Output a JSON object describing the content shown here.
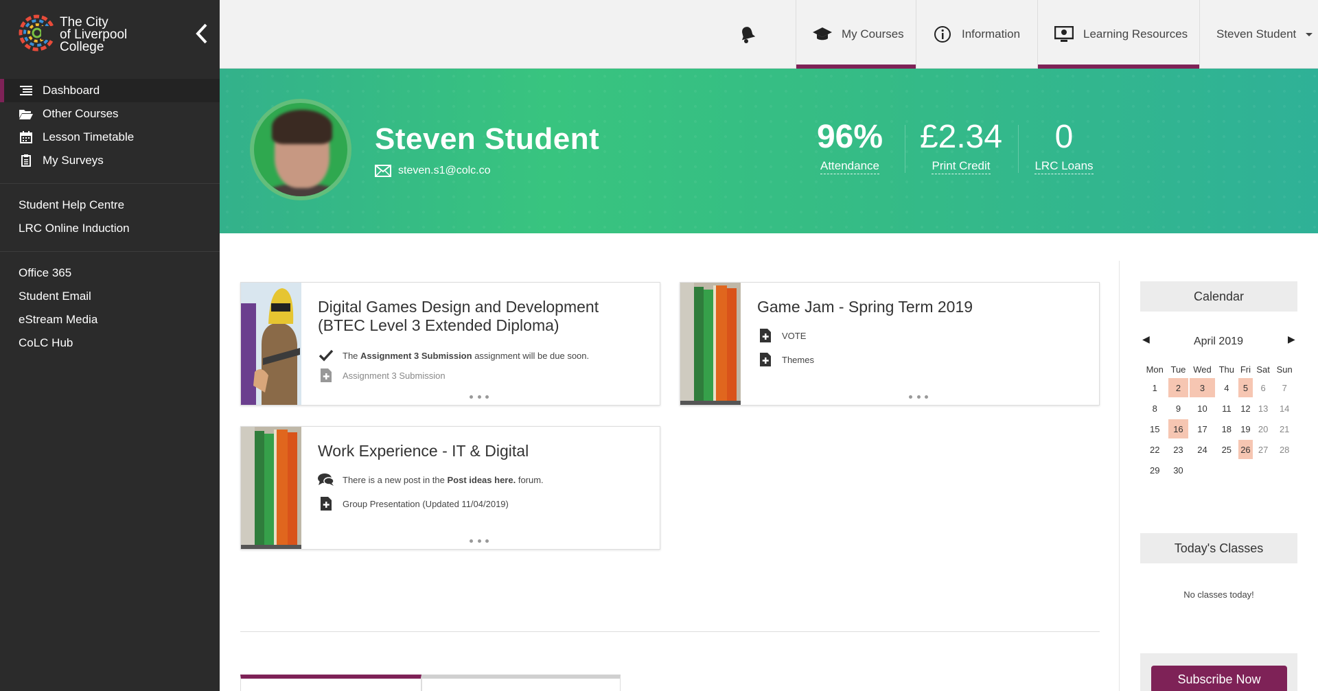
{
  "brand": {
    "name_line1": "The City",
    "name_line2": "of Liverpool",
    "name_line3": "College"
  },
  "sidebar": {
    "primary": [
      {
        "label": "Dashboard",
        "icon": "list-icon",
        "active": true
      },
      {
        "label": "Other Courses",
        "icon": "folder-open-icon"
      },
      {
        "label": "Lesson Timetable",
        "icon": "calendar-icon"
      },
      {
        "label": "My Surveys",
        "icon": "clipboard-icon"
      }
    ],
    "help": [
      "Student Help Centre",
      "LRC Online Induction"
    ],
    "links": [
      "Office 365",
      "Student Email",
      "eStream Media",
      "CoLC Hub"
    ]
  },
  "topnav": {
    "tabs": [
      {
        "label": "My Courses",
        "icon": "graduation-cap-icon"
      },
      {
        "label": "Information",
        "icon": "info-icon"
      },
      {
        "label": "Learning Resources",
        "icon": "monitor-icon"
      }
    ],
    "user": "Steven Student"
  },
  "profile": {
    "name": "Steven Student",
    "email": "steven.s1@colc.co",
    "stats": [
      {
        "value": "96%",
        "label": "Attendance"
      },
      {
        "value": "£2.34",
        "label": "Print Credit"
      },
      {
        "value": "0",
        "label": "LRC Loans"
      }
    ]
  },
  "courses": [
    {
      "title": "Digital Games Design and Development (BTEC Level 3 Extended Diploma)",
      "rows": [
        {
          "icon": "check-icon",
          "pre": "The",
          "bold": "Assignment 3 Submission",
          "post": "assignment will be due soon."
        },
        {
          "icon": "file-plus-icon",
          "text": "Assignment 3 Submission"
        }
      ]
    },
    {
      "title": "Game Jam - Spring Term 2019",
      "rows": [
        {
          "icon": "file-plus-icon",
          "text": "VOTE"
        },
        {
          "icon": "file-plus-icon",
          "text": "Themes"
        }
      ]
    },
    {
      "title": "Work Experience - IT & Digital",
      "rows": [
        {
          "icon": "comments-icon",
          "pre": "There is a new post in the",
          "bold": "Post ideas here.",
          "post": "forum."
        },
        {
          "icon": "file-plus-icon",
          "text": "Group Presentation (Updated 11/04/2019)"
        }
      ]
    }
  ],
  "calendar": {
    "heading": "Calendar",
    "month": "April 2019",
    "days": [
      "Mon",
      "Tue",
      "Wed",
      "Thu",
      "Fri",
      "Sat",
      "Sun"
    ],
    "weeks": [
      [
        "1",
        "2",
        "3",
        "4",
        "5",
        "6",
        "7"
      ],
      [
        "8",
        "9",
        "10",
        "11",
        "12",
        "13",
        "14"
      ],
      [
        "15",
        "16",
        "17",
        "18",
        "19",
        "20",
        "21"
      ],
      [
        "22",
        "23",
        "24",
        "25",
        "26",
        "27",
        "28"
      ],
      [
        "29",
        "30",
        "",
        "",
        "",
        "",
        ""
      ]
    ],
    "events": [
      "2",
      "3",
      "5",
      "16",
      "26"
    ],
    "prev": "◀",
    "next": "▶"
  },
  "today_classes": {
    "heading": "Today's Classes",
    "empty": "No classes today!"
  },
  "subscribe_label": "Subscribe Now",
  "colors": {
    "accent": "#7e2257",
    "hero": "#38c47f",
    "event": "#f6c6b2",
    "sidebar": "#2b2b2b"
  }
}
